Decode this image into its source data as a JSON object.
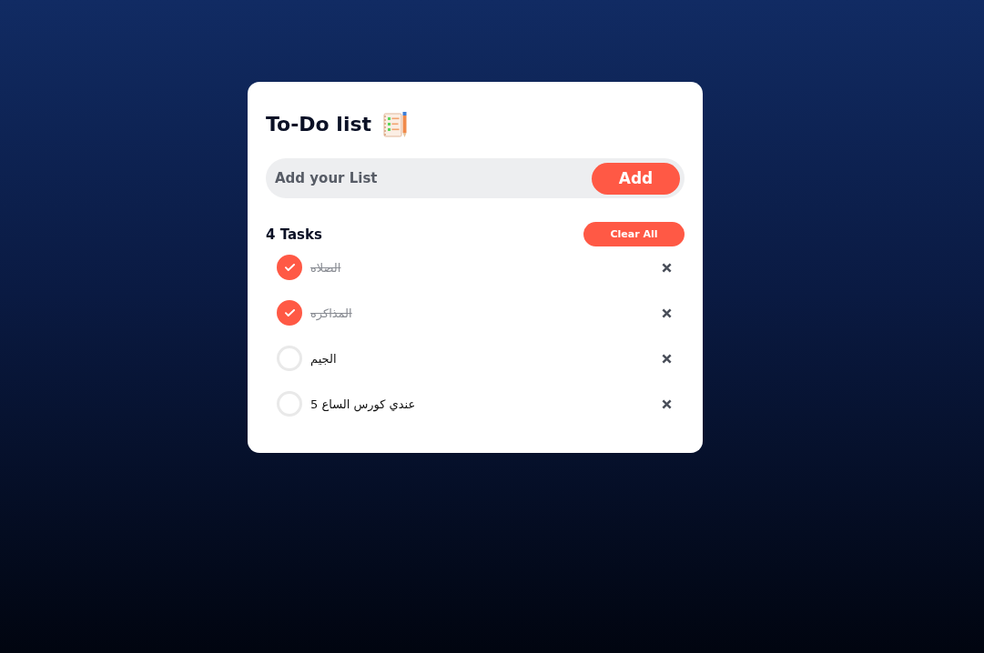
{
  "card": {
    "title": "To-Do list",
    "input": {
      "placeholder": "Add your List"
    },
    "add_button": "Add",
    "task_count": "4 Tasks",
    "clear_button": "Clear All",
    "tasks": [
      {
        "text": "الصلاه",
        "checked": true
      },
      {
        "text": "المذاكره",
        "checked": true
      },
      {
        "text": "الجيم",
        "checked": false
      },
      {
        "text": "عندي كورس الساع 5",
        "checked": false
      }
    ]
  }
}
